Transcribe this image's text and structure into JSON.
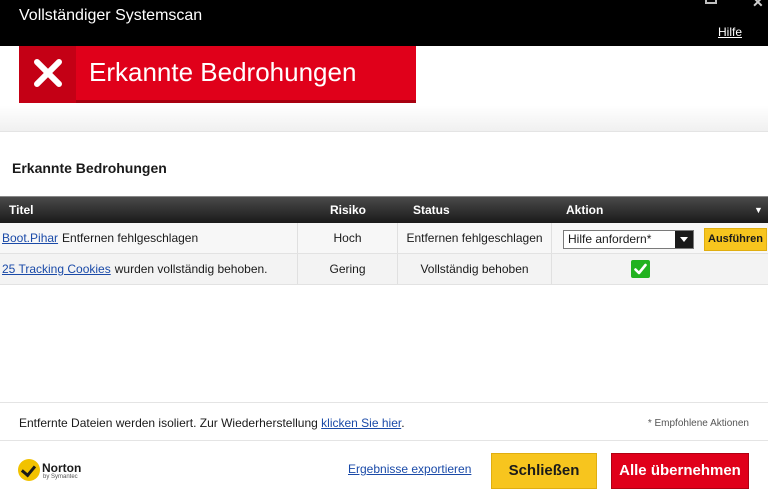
{
  "window": {
    "title": "Vollständiger Systemscan",
    "help_label": "Hilfe"
  },
  "banner": {
    "title": "Erkannte Bedrohungen",
    "icon": "close-x-icon"
  },
  "section": {
    "title": "Erkannte Bedrohungen"
  },
  "table": {
    "columns": [
      "Titel",
      "Risiko",
      "Status",
      "Aktion"
    ],
    "rows": [
      {
        "threat_link": "Boot.Pihar",
        "description": "Entfernen fehlgeschlagen",
        "risk": "Hoch",
        "status": "Entfernen fehlgeschlagen",
        "action_select": "Hilfe anfordern*",
        "action_button": "Ausführen"
      },
      {
        "threat_link": "25 Tracking Cookies",
        "description": "wurden vollständig behoben.",
        "risk": "Gering",
        "status": "Vollständig behoben",
        "action_icon": "checkmark-icon"
      }
    ]
  },
  "info": {
    "text": "Entfernte Dateien werden isoliert. Zur Wiederherstellung",
    "link": "klicken Sie hier",
    "suffix": ".",
    "recommended": "* Empfohlene Aktionen"
  },
  "footer": {
    "brand": "Norton",
    "brand_sub": "by Symantec",
    "export_link": "Ergebnisse exportieren",
    "close_button": "Schließen",
    "apply_button": "Alle übernehmen"
  },
  "colors": {
    "brand_red": "#e0001a",
    "brand_yellow": "#f7c51e",
    "link_blue": "#1a4aa8",
    "success_green": "#21b21f"
  }
}
